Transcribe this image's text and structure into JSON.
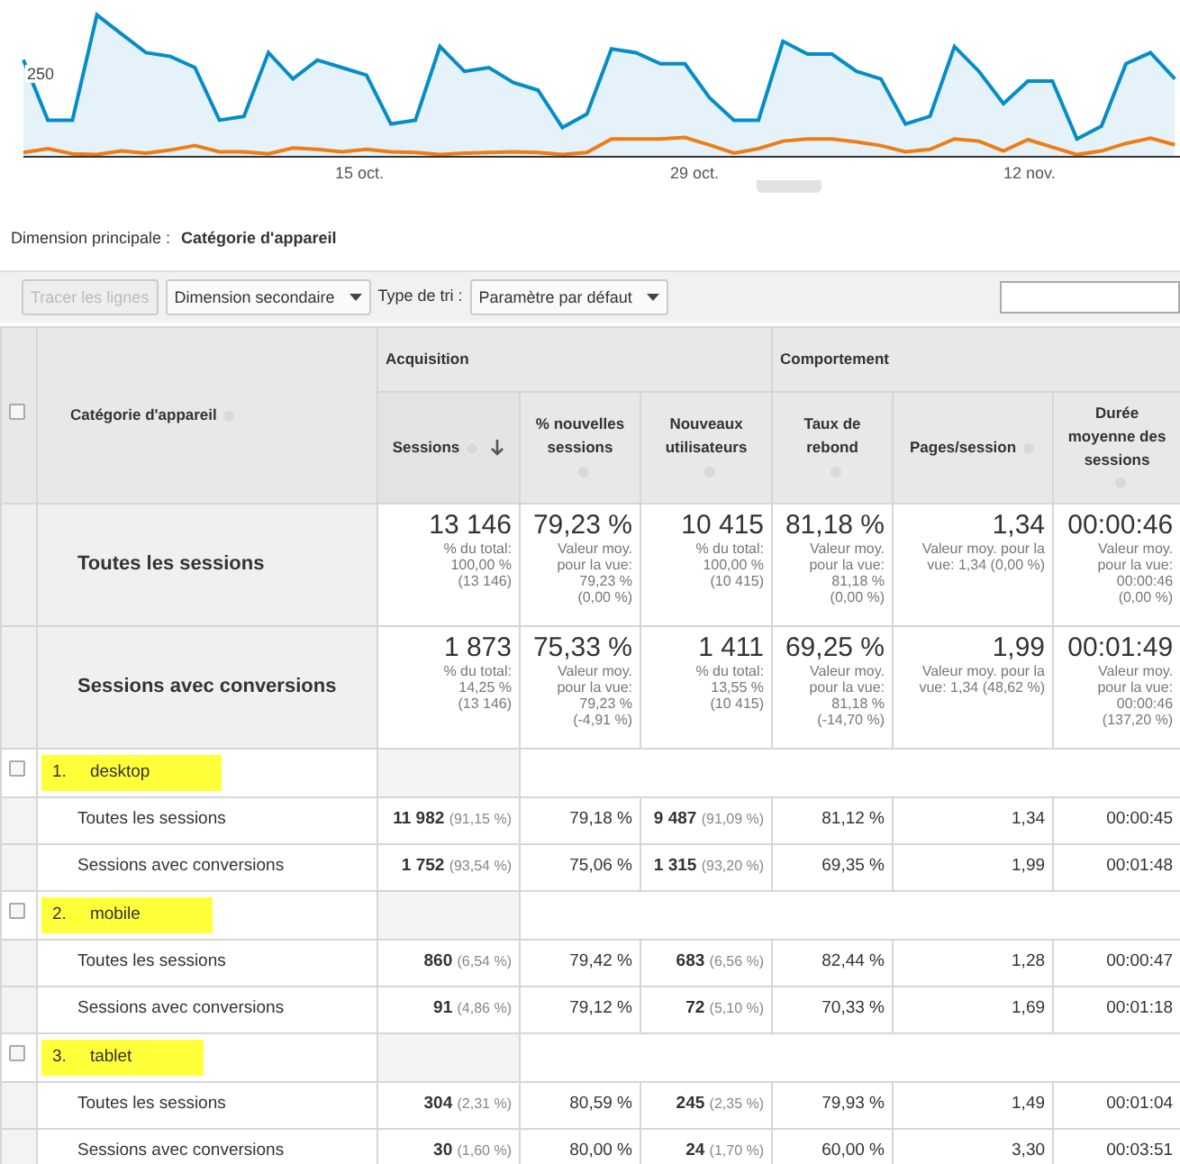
{
  "chart": {
    "y_label": "250",
    "x_labels": [
      "15 oct.",
      "29 oct.",
      "12 nov."
    ]
  },
  "primary_dimension": {
    "label": "Dimension principale :",
    "value": "Catégorie d'appareil"
  },
  "toolbar": {
    "plot_button": {
      "label": "Tracer les lignes",
      "disabled": true
    },
    "secondary_dimension": "Dimension secondaire",
    "sort_label": "Type de tri :",
    "sort_value": "Paramètre par défaut"
  },
  "table": {
    "select_all": {
      "checked": false
    },
    "dimension_header": "Catégorie d'appareil",
    "groups": [
      {
        "label": "Acquisition"
      },
      {
        "label": "Comportement"
      }
    ],
    "columns": [
      {
        "label": "Sessions",
        "sorted": true
      },
      {
        "label": "% nouvelles sessions",
        "sorted": false
      },
      {
        "label": "Nouveaux utilisateurs",
        "sorted": false
      },
      {
        "label": "Taux de rebond",
        "sorted": false
      },
      {
        "label": "Pages/session",
        "sorted": false
      },
      {
        "label": "Durée moyenne des sessions",
        "sorted": false
      }
    ],
    "totals": [
      {
        "label": "Toutes les sessions",
        "cells": [
          {
            "value": "13 146",
            "note": "% du total:\n100,00 %\n(13 146)"
          },
          {
            "value": "79,23 %",
            "note": "Valeur moy.\npour la vue:\n79,23 %\n(0,00 %)"
          },
          {
            "value": "10 415",
            "note": "% du total:\n100,00 %\n(10 415)"
          },
          {
            "value": "81,18 %",
            "note": "Valeur moy.\npour la vue:\n81,18 %\n(0,00 %)"
          },
          {
            "value": "1,34",
            "note": "Valeur moy. pour la\nvue: 1,34 (0,00 %)"
          },
          {
            "value": "00:00:46",
            "note": "Valeur moy.\npour la vue:\n00:00:46\n(0,00 %)"
          }
        ]
      },
      {
        "label": "Sessions avec conversions",
        "cells": [
          {
            "value": "1 873",
            "note": "% du total:\n14,25 %\n(13 146)"
          },
          {
            "value": "75,33 %",
            "note": "Valeur moy.\npour la vue:\n79,23 %\n(-4,91 %)"
          },
          {
            "value": "1 411",
            "note": "% du total:\n13,55 %\n(10 415)"
          },
          {
            "value": "69,25 %",
            "note": "Valeur moy.\npour la vue:\n81,18 %\n(-14,70 %)"
          },
          {
            "value": "1,99",
            "note": "Valeur moy. pour la\nvue: 1,34 (48,62 %)"
          },
          {
            "value": "00:01:49",
            "note": "Valeur moy.\npour la vue:\n00:00:46\n(137,20 %)"
          }
        ]
      }
    ],
    "rows": [
      {
        "index": "1.",
        "name": "desktop",
        "checked": false,
        "highlighted": true,
        "segments": [
          {
            "label": "Toutes les sessions",
            "cells": [
              {
                "value": "11 982",
                "share": "(91,15 %)"
              },
              {
                "value": "79,18 %"
              },
              {
                "value": "9 487",
                "share": "(91,09 %)"
              },
              {
                "value": "81,12 %"
              },
              {
                "value": "1,34"
              },
              {
                "value": "00:00:45"
              }
            ]
          },
          {
            "label": "Sessions avec conversions",
            "cells": [
              {
                "value": "1 752",
                "share": "(93,54 %)"
              },
              {
                "value": "75,06 %"
              },
              {
                "value": "1 315",
                "share": "(93,20 %)"
              },
              {
                "value": "69,35 %"
              },
              {
                "value": "1,99"
              },
              {
                "value": "00:01:48"
              }
            ]
          }
        ]
      },
      {
        "index": "2.",
        "name": "mobile",
        "checked": false,
        "highlighted": true,
        "segments": [
          {
            "label": "Toutes les sessions",
            "cells": [
              {
                "value": "860",
                "share": "(6,54 %)"
              },
              {
                "value": "79,42 %"
              },
              {
                "value": "683",
                "share": "(6,56 %)"
              },
              {
                "value": "82,44 %"
              },
              {
                "value": "1,28"
              },
              {
                "value": "00:00:47"
              }
            ]
          },
          {
            "label": "Sessions avec conversions",
            "cells": [
              {
                "value": "91",
                "share": "(4,86 %)"
              },
              {
                "value": "79,12 %"
              },
              {
                "value": "72",
                "share": "(5,10 %)"
              },
              {
                "value": "70,33 %"
              },
              {
                "value": "1,69"
              },
              {
                "value": "00:01:18"
              }
            ]
          }
        ]
      },
      {
        "index": "3.",
        "name": "tablet",
        "checked": false,
        "highlighted": true,
        "segments": [
          {
            "label": "Toutes les sessions",
            "cells": [
              {
                "value": "304",
                "share": "(2,31 %)"
              },
              {
                "value": "80,59 %"
              },
              {
                "value": "245",
                "share": "(2,35 %)"
              },
              {
                "value": "79,93 %"
              },
              {
                "value": "1,49"
              },
              {
                "value": "00:01:04"
              }
            ]
          },
          {
            "label": "Sessions avec conversions",
            "cells": [
              {
                "value": "30",
                "share": "(1,60 %)"
              },
              {
                "value": "80,00 %"
              },
              {
                "value": "24",
                "share": "(1,70 %)"
              },
              {
                "value": "60,00 %"
              },
              {
                "value": "3,30"
              },
              {
                "value": "00:03:51"
              }
            ]
          }
        ]
      }
    ]
  }
}
